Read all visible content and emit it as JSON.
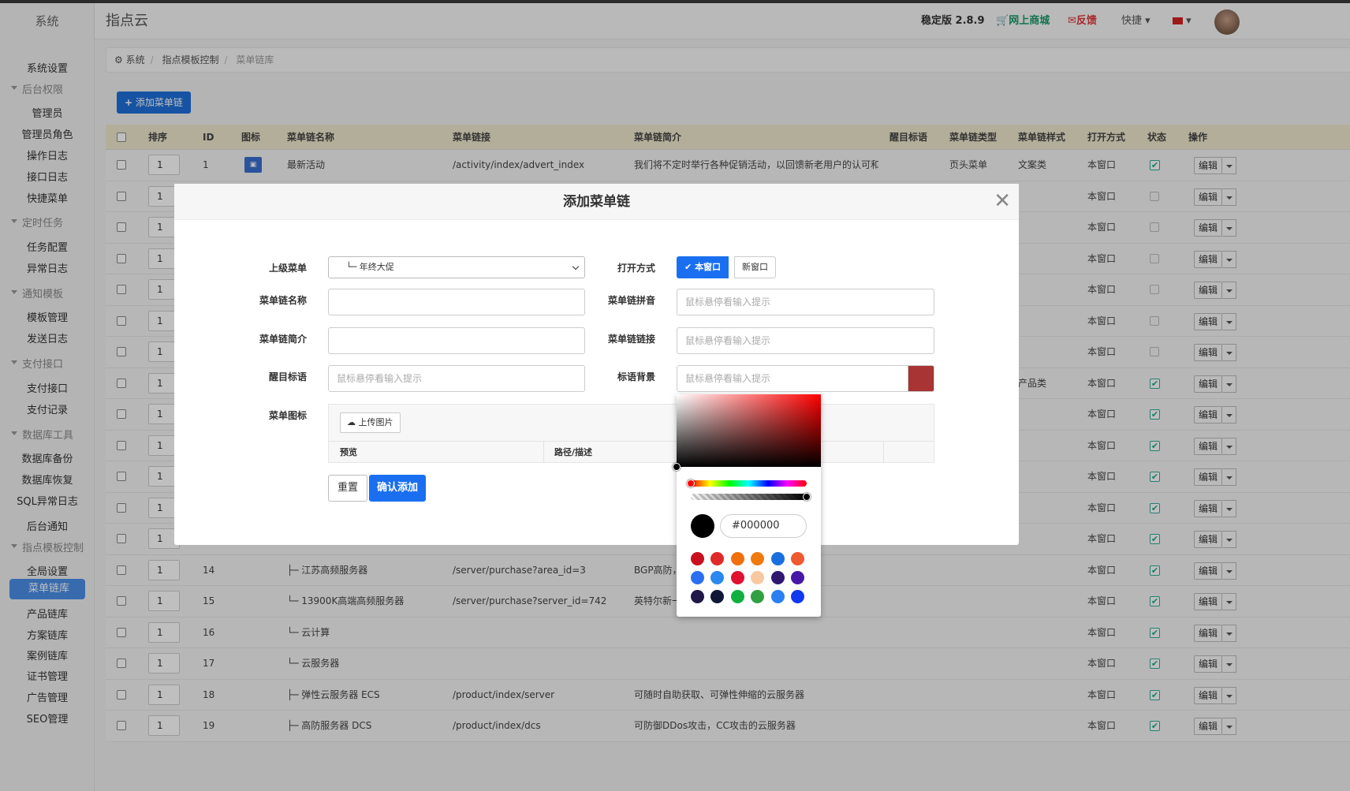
{
  "app": {
    "side_title": "系统",
    "brand": "指点云"
  },
  "header": {
    "version": "稳定版 2.8.9",
    "shop": "网上商城",
    "feedback": "反馈",
    "quick": "快捷",
    "colors": {
      "shop": "#1a9a6a",
      "feedback": "#e0353a"
    }
  },
  "sidebar": {
    "items": [
      {
        "label": "系统设置",
        "type": "item"
      },
      {
        "label": "后台权限",
        "type": "group"
      },
      {
        "label": "管理员",
        "type": "item"
      },
      {
        "label": "管理员角色",
        "type": "item"
      },
      {
        "label": "操作日志",
        "type": "item"
      },
      {
        "label": "接口日志",
        "type": "item"
      },
      {
        "label": "快捷菜单",
        "type": "item"
      },
      {
        "label": "定时任务",
        "type": "group"
      },
      {
        "label": "任务配置",
        "type": "item"
      },
      {
        "label": "异常日志",
        "type": "item"
      },
      {
        "label": "通知模板",
        "type": "group"
      },
      {
        "label": "模板管理",
        "type": "item"
      },
      {
        "label": "发送日志",
        "type": "item"
      },
      {
        "label": "支付接口",
        "type": "group"
      },
      {
        "label": "支付接口",
        "type": "item"
      },
      {
        "label": "支付记录",
        "type": "item"
      },
      {
        "label": "数据库工具",
        "type": "group"
      },
      {
        "label": "数据库备份",
        "type": "item"
      },
      {
        "label": "数据库恢复",
        "type": "item"
      },
      {
        "label": "SQL异常日志",
        "type": "item"
      },
      {
        "label": "后台通知",
        "type": "item"
      },
      {
        "label": "指点模板控制",
        "type": "group"
      },
      {
        "label": "全局设置",
        "type": "item"
      },
      {
        "label": "菜单链库",
        "type": "active"
      },
      {
        "label": "产品链库",
        "type": "item"
      },
      {
        "label": "方案链库",
        "type": "item"
      },
      {
        "label": "案例链库",
        "type": "item"
      },
      {
        "label": "证书管理",
        "type": "item"
      },
      {
        "label": "广告管理",
        "type": "item"
      },
      {
        "label": "SEO管理",
        "type": "item"
      }
    ]
  },
  "breadcrumb": {
    "root": "系统",
    "mid": "指点模板控制",
    "current": "菜单链库"
  },
  "toolbar": {
    "add_label": "添加菜单链"
  },
  "table": {
    "headers": [
      "排序",
      "ID",
      "图标",
      "菜单链名称",
      "菜单链接",
      "菜单链简介",
      "醒目标语",
      "菜单链类型",
      "菜单链样式",
      "打开方式",
      "状态",
      "操作"
    ],
    "edit_label": "编辑",
    "rows": [
      {
        "sort": "1",
        "id": "1",
        "icon": true,
        "name": "最新活动",
        "link": "/activity/index/advert_index",
        "intro": "我们将不定时举行各种促销活动，以回馈新老用户的认可和...",
        "type": "页头菜单",
        "style": "文案类",
        "open": "本窗口",
        "status": true
      },
      {
        "sort": "1",
        "id": "",
        "name": "",
        "link": "",
        "intro": "",
        "type": "",
        "style": "",
        "open": "本窗口",
        "status": false
      },
      {
        "sort": "1",
        "id": "",
        "name": "",
        "link": "",
        "intro": "",
        "type": "",
        "style": "",
        "open": "本窗口",
        "status": false
      },
      {
        "sort": "1",
        "id": "",
        "name": "",
        "link": "",
        "intro": "",
        "type": "",
        "style": "",
        "open": "本窗口",
        "status": false
      },
      {
        "sort": "1",
        "id": "",
        "name": "",
        "link": "",
        "intro": "",
        "type": "",
        "style": "",
        "open": "本窗口",
        "status": false
      },
      {
        "sort": "1",
        "id": "",
        "name": "",
        "link": "",
        "intro": "",
        "type": "",
        "style": "",
        "open": "本窗口",
        "status": false
      },
      {
        "sort": "1",
        "id": "",
        "name": "",
        "link": "",
        "intro": "",
        "type": "",
        "style": "",
        "open": "本窗口",
        "status": false
      },
      {
        "sort": "1",
        "id": "",
        "name": "",
        "link": "",
        "intro": "",
        "type": "",
        "style": "产品类",
        "open": "本窗口",
        "status": true
      },
      {
        "sort": "1",
        "id": "",
        "name": "",
        "link": "",
        "intro": "",
        "type": "",
        "style": "",
        "open": "本窗口",
        "status": true
      },
      {
        "sort": "1",
        "id": "",
        "name": "",
        "link": "",
        "intro": "",
        "type": "",
        "style": "",
        "open": "本窗口",
        "status": true
      },
      {
        "sort": "1",
        "id": "",
        "name": "",
        "link": "",
        "intro": "",
        "type": "",
        "style": "",
        "open": "本窗口",
        "status": true
      },
      {
        "sort": "1",
        "id": "",
        "name": "",
        "link": "",
        "intro": "",
        "type": "",
        "style": "",
        "open": "本窗口",
        "status": true
      },
      {
        "sort": "1",
        "id": "",
        "name": "",
        "link": "",
        "intro": "",
        "type": "",
        "style": "",
        "open": "本窗口",
        "status": true
      },
      {
        "sort": "1",
        "id": "14",
        "name": "├─ 江苏高频服务器",
        "link": "/server/purchase?area_id=3",
        "intro": "BGP高防，",
        "type": "",
        "style": "",
        "open": "本窗口",
        "status": true
      },
      {
        "sort": "1",
        "id": "15",
        "name": "└─ 13900K高端高频服务器",
        "link": "/server/purchase?server_id=742",
        "intro": "英特尔新一",
        "type": "",
        "style": "",
        "open": "本窗口",
        "status": true
      },
      {
        "sort": "1",
        "id": "16",
        "name": "└─ 云计算",
        "link": "",
        "intro": "",
        "type": "",
        "style": "",
        "open": "本窗口",
        "status": true
      },
      {
        "sort": "1",
        "id": "17",
        "name": "└─ 云服务器",
        "link": "",
        "intro": "",
        "type": "",
        "style": "",
        "open": "本窗口",
        "status": true
      },
      {
        "sort": "1",
        "id": "18",
        "name": "├─ 弹性云服务器 ECS",
        "link": "/product/index/server",
        "intro": "可随时自助获取、可弹性伸缩的云服务器",
        "type": "",
        "style": "",
        "open": "本窗口",
        "status": true
      },
      {
        "sort": "1",
        "id": "19",
        "name": "├─ 高防服务器 DCS",
        "link": "/product/index/dcs",
        "intro": "可防御DDos攻击，CC攻击的云服务器",
        "type": "",
        "style": "",
        "open": "本窗口",
        "status": true
      }
    ]
  },
  "modal": {
    "title": "添加菜单链",
    "parent_label": "上级菜单",
    "parent_value": "└─ 年终大促",
    "open_label": "打开方式",
    "open_self": "本窗口",
    "open_new": "新窗口",
    "name_label": "菜单链名称",
    "pinyin_label": "菜单链拼音",
    "pinyin_placeholder": "鼠标悬停看输入提示",
    "intro_label": "菜单链简介",
    "link_label": "菜单链链接",
    "link_placeholder": "鼠标悬停看输入提示",
    "slogan_label": "醒目标语",
    "slogan_placeholder": "鼠标悬停看输入提示",
    "slogan_bg_label": "标语背景",
    "slogan_bg_placeholder": "鼠标悬停看输入提示",
    "slogan_bg_color": "#a83434",
    "icon_label": "菜单图标",
    "upload_label": "上传图片",
    "col_preview": "预览",
    "col_path": "路径/描述",
    "reset_label": "重置",
    "submit_label": "确认添加"
  },
  "picker": {
    "hex": "#000000",
    "swatches": [
      "#c8101e",
      "#e02a2a",
      "#f07010",
      "#f07a10",
      "#1a6fe0",
      "#f05a30",
      "#2a6ff0",
      "#2a88f0",
      "#e01030",
      "#f8c8a0",
      "#301870",
      "#4818a8",
      "#201848",
      "#101838",
      "#10b040",
      "#30a040",
      "#2a80f0",
      "#1038f0"
    ]
  }
}
